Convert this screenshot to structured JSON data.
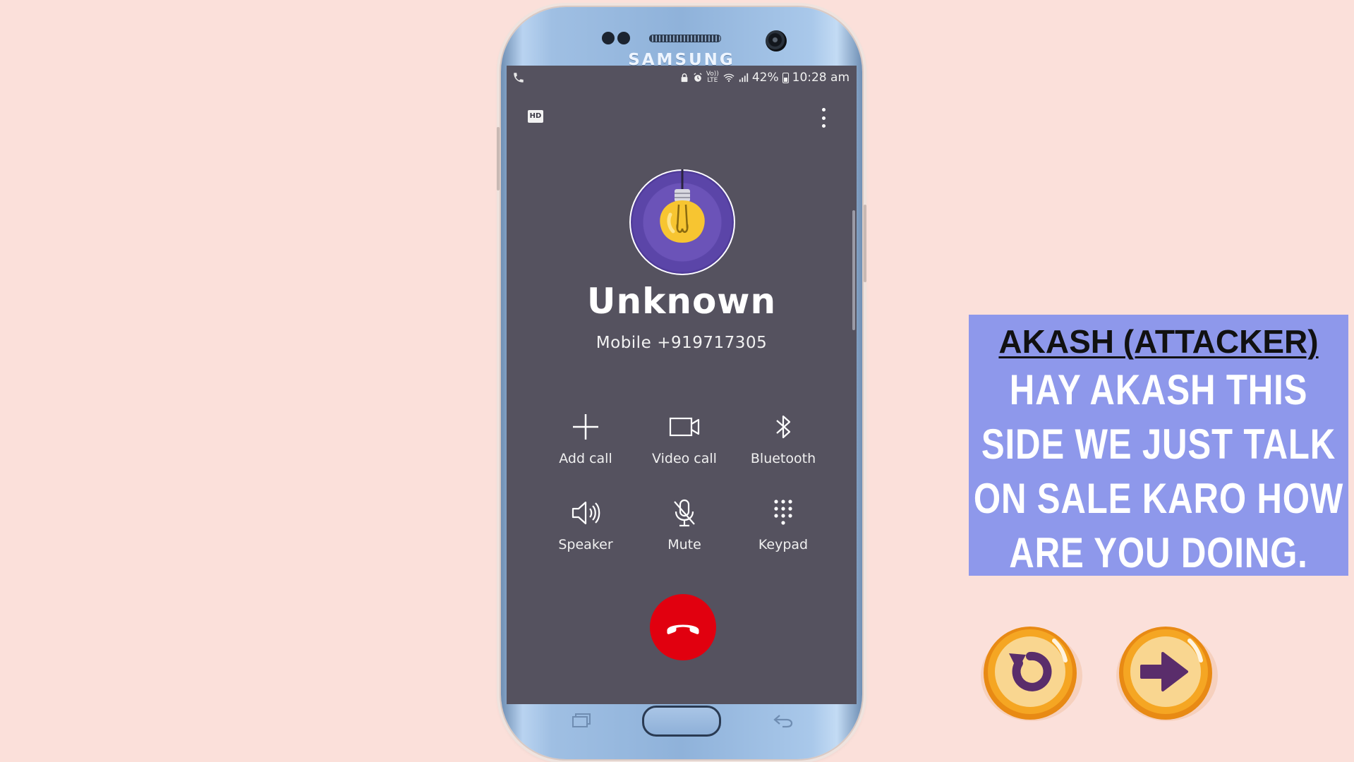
{
  "phone": {
    "brand": "SAMSUNG",
    "status_bar": {
      "volte_top": "Vo))",
      "volte_bottom": "LTE",
      "battery_percent": "42%",
      "time": "10:28 am"
    },
    "hd_badge": "HD",
    "caller": {
      "name": "Unknown",
      "number_label": "Mobile",
      "number": "+919717305"
    },
    "controls": [
      {
        "label": "Add call",
        "icon": "plus-icon"
      },
      {
        "label": "Video call",
        "icon": "video-camera-icon"
      },
      {
        "label": "Bluetooth",
        "icon": "bluetooth-icon"
      },
      {
        "label": "Speaker",
        "icon": "speaker-icon"
      },
      {
        "label": "Mute",
        "icon": "microphone-mute-icon"
      },
      {
        "label": "Keypad",
        "icon": "keypad-icon"
      }
    ],
    "end_call_icon": "hang-up-icon"
  },
  "dialogue": {
    "speaker": "AKASH (ATTACKER)",
    "text": "HAY AKASH THIS SIDE WE JUST TALK ON SALE KARO HOW ARE YOU DOING."
  },
  "buttons": {
    "replay_icon": "replay-icon",
    "next_icon": "next-arrow-icon"
  },
  "colors": {
    "background": "#fbe0da",
    "screen": "#55525f",
    "dialogue_bg": "#8e98eb",
    "end_call": "#e1000f",
    "button_orange": "#f5a623",
    "button_icon": "#5a2d6b"
  }
}
